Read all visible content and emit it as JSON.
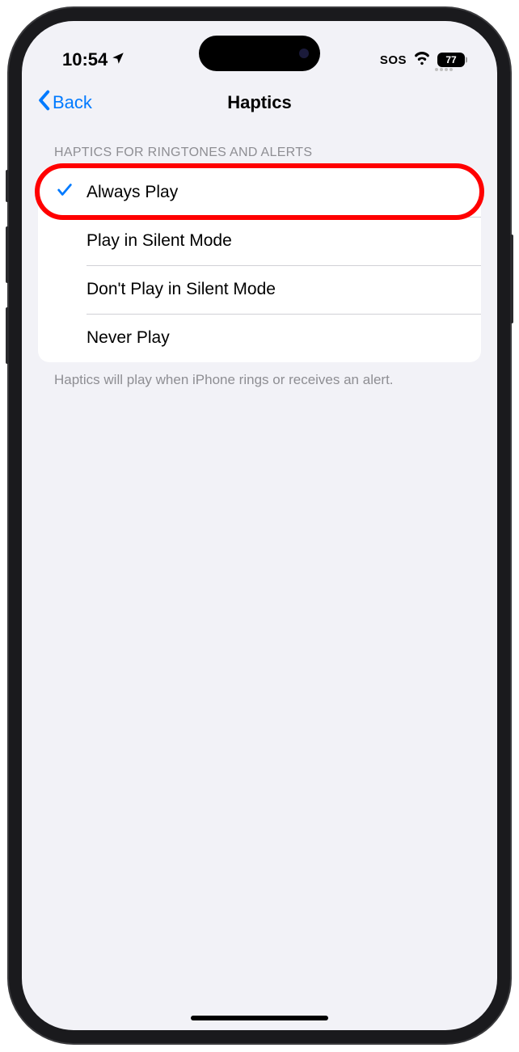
{
  "status_bar": {
    "time": "10:54",
    "sos": "SOS",
    "battery": "77"
  },
  "nav": {
    "back_label": "Back",
    "title": "Haptics"
  },
  "section": {
    "header": "HAPTICS FOR RINGTONES AND ALERTS",
    "footer": "Haptics will play when iPhone rings or receives an alert."
  },
  "options": [
    {
      "label": "Always Play",
      "selected": true
    },
    {
      "label": "Play in Silent Mode",
      "selected": false
    },
    {
      "label": "Don't Play in Silent Mode",
      "selected": false
    },
    {
      "label": "Never Play",
      "selected": false
    }
  ]
}
